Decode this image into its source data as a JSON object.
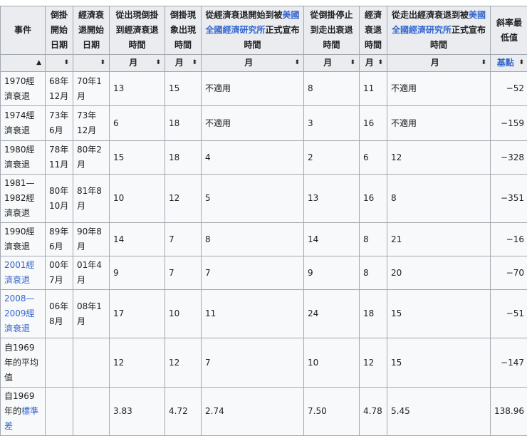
{
  "colors": {
    "link": "#3366cc",
    "header_bg": "#eaecf0",
    "cell_bg": "#f8f9fa",
    "border": "#a2a9b1"
  },
  "headers": [
    {
      "parts": [
        {
          "t": "事件"
        }
      ]
    },
    {
      "parts": [
        {
          "t": "倒掛開始日期"
        }
      ]
    },
    {
      "parts": [
        {
          "t": "經濟衰退開始日期"
        }
      ]
    },
    {
      "parts": [
        {
          "t": "從出現倒掛到經濟衰退時間"
        }
      ]
    },
    {
      "parts": [
        {
          "t": "倒掛現象出現時間"
        }
      ]
    },
    {
      "parts": [
        {
          "t": "從經濟衰退開始到被"
        },
        {
          "t": "美國全國經濟研究所",
          "link": true
        },
        {
          "t": "正式宣布時間"
        }
      ]
    },
    {
      "parts": [
        {
          "t": "從倒掛停止到走出衰退時間"
        }
      ]
    },
    {
      "parts": [
        {
          "t": "經濟衰退時間"
        }
      ]
    },
    {
      "parts": [
        {
          "t": "從走出經濟衰退到被"
        },
        {
          "t": "美國全國經濟研究所",
          "link": true
        },
        {
          "t": "正式宣布時間"
        }
      ]
    },
    {
      "parts": [
        {
          "t": "斜率最低值"
        }
      ]
    }
  ],
  "units": [
    {
      "t": "",
      "sort": "▲"
    },
    {
      "t": "",
      "sort": "⬍"
    },
    {
      "t": "",
      "sort": "⬍"
    },
    {
      "t": "月",
      "sort": "⬍"
    },
    {
      "t": "月",
      "sort": "⬍"
    },
    {
      "t": "月",
      "sort": "⬍"
    },
    {
      "t": "月",
      "sort": "⬍"
    },
    {
      "t": "月",
      "sort": "⬍"
    },
    {
      "t": "月",
      "sort": "⬍"
    },
    {
      "t": "基點",
      "sort": "⬍",
      "link": true
    }
  ],
  "rows": [
    {
      "event": [
        {
          "t": "1970經濟衰退"
        }
      ],
      "cells": [
        "68年12月",
        "70年1月",
        "13",
        "15",
        "不適用",
        "8",
        "11",
        "不適用",
        "−52"
      ]
    },
    {
      "event": [
        {
          "t": "1974經濟衰退"
        }
      ],
      "cells": [
        "73年6月",
        "73年12月",
        "6",
        "18",
        "不適用",
        "3",
        "16",
        "不適用",
        "−159"
      ]
    },
    {
      "event": [
        {
          "t": "1980經濟衰退"
        }
      ],
      "cells": [
        "78年11月",
        "80年2月",
        "15",
        "18",
        "4",
        "2",
        "6",
        "12",
        "−328"
      ]
    },
    {
      "event": [
        {
          "t": "1981—1982經濟衰退"
        }
      ],
      "cells": [
        "80年10月",
        "81年8月",
        "10",
        "12",
        "5",
        "13",
        "16",
        "8",
        "−351"
      ]
    },
    {
      "event": [
        {
          "t": "1990經濟衰退"
        }
      ],
      "cells": [
        "89年6月",
        "90年8月",
        "14",
        "7",
        "8",
        "14",
        "8",
        "21",
        "−16"
      ]
    },
    {
      "event": [
        {
          "t": "2001經濟衰退",
          "link": true
        }
      ],
      "cells": [
        "00年7月",
        "01年4月",
        "9",
        "7",
        "7",
        "9",
        "8",
        "20",
        "−70"
      ]
    },
    {
      "event": [
        {
          "t": "2008—2009經濟衰退",
          "link": true
        }
      ],
      "cells": [
        "06年8月",
        "08年1月",
        "17",
        "10",
        "11",
        "24",
        "18",
        "15",
        "−51"
      ]
    },
    {
      "event": [
        {
          "t": "自1969年的平均值"
        }
      ],
      "cells": [
        "",
        "",
        "12",
        "12",
        "7",
        "10",
        "12",
        "15",
        "−147"
      ]
    },
    {
      "event": [
        {
          "t": "自1969年的"
        },
        {
          "t": "標準差",
          "link": true
        }
      ],
      "cells": [
        "",
        "",
        "3.83",
        "4.72",
        "2.74",
        "7.50",
        "4.78",
        "5.45",
        "138.96"
      ]
    }
  ]
}
